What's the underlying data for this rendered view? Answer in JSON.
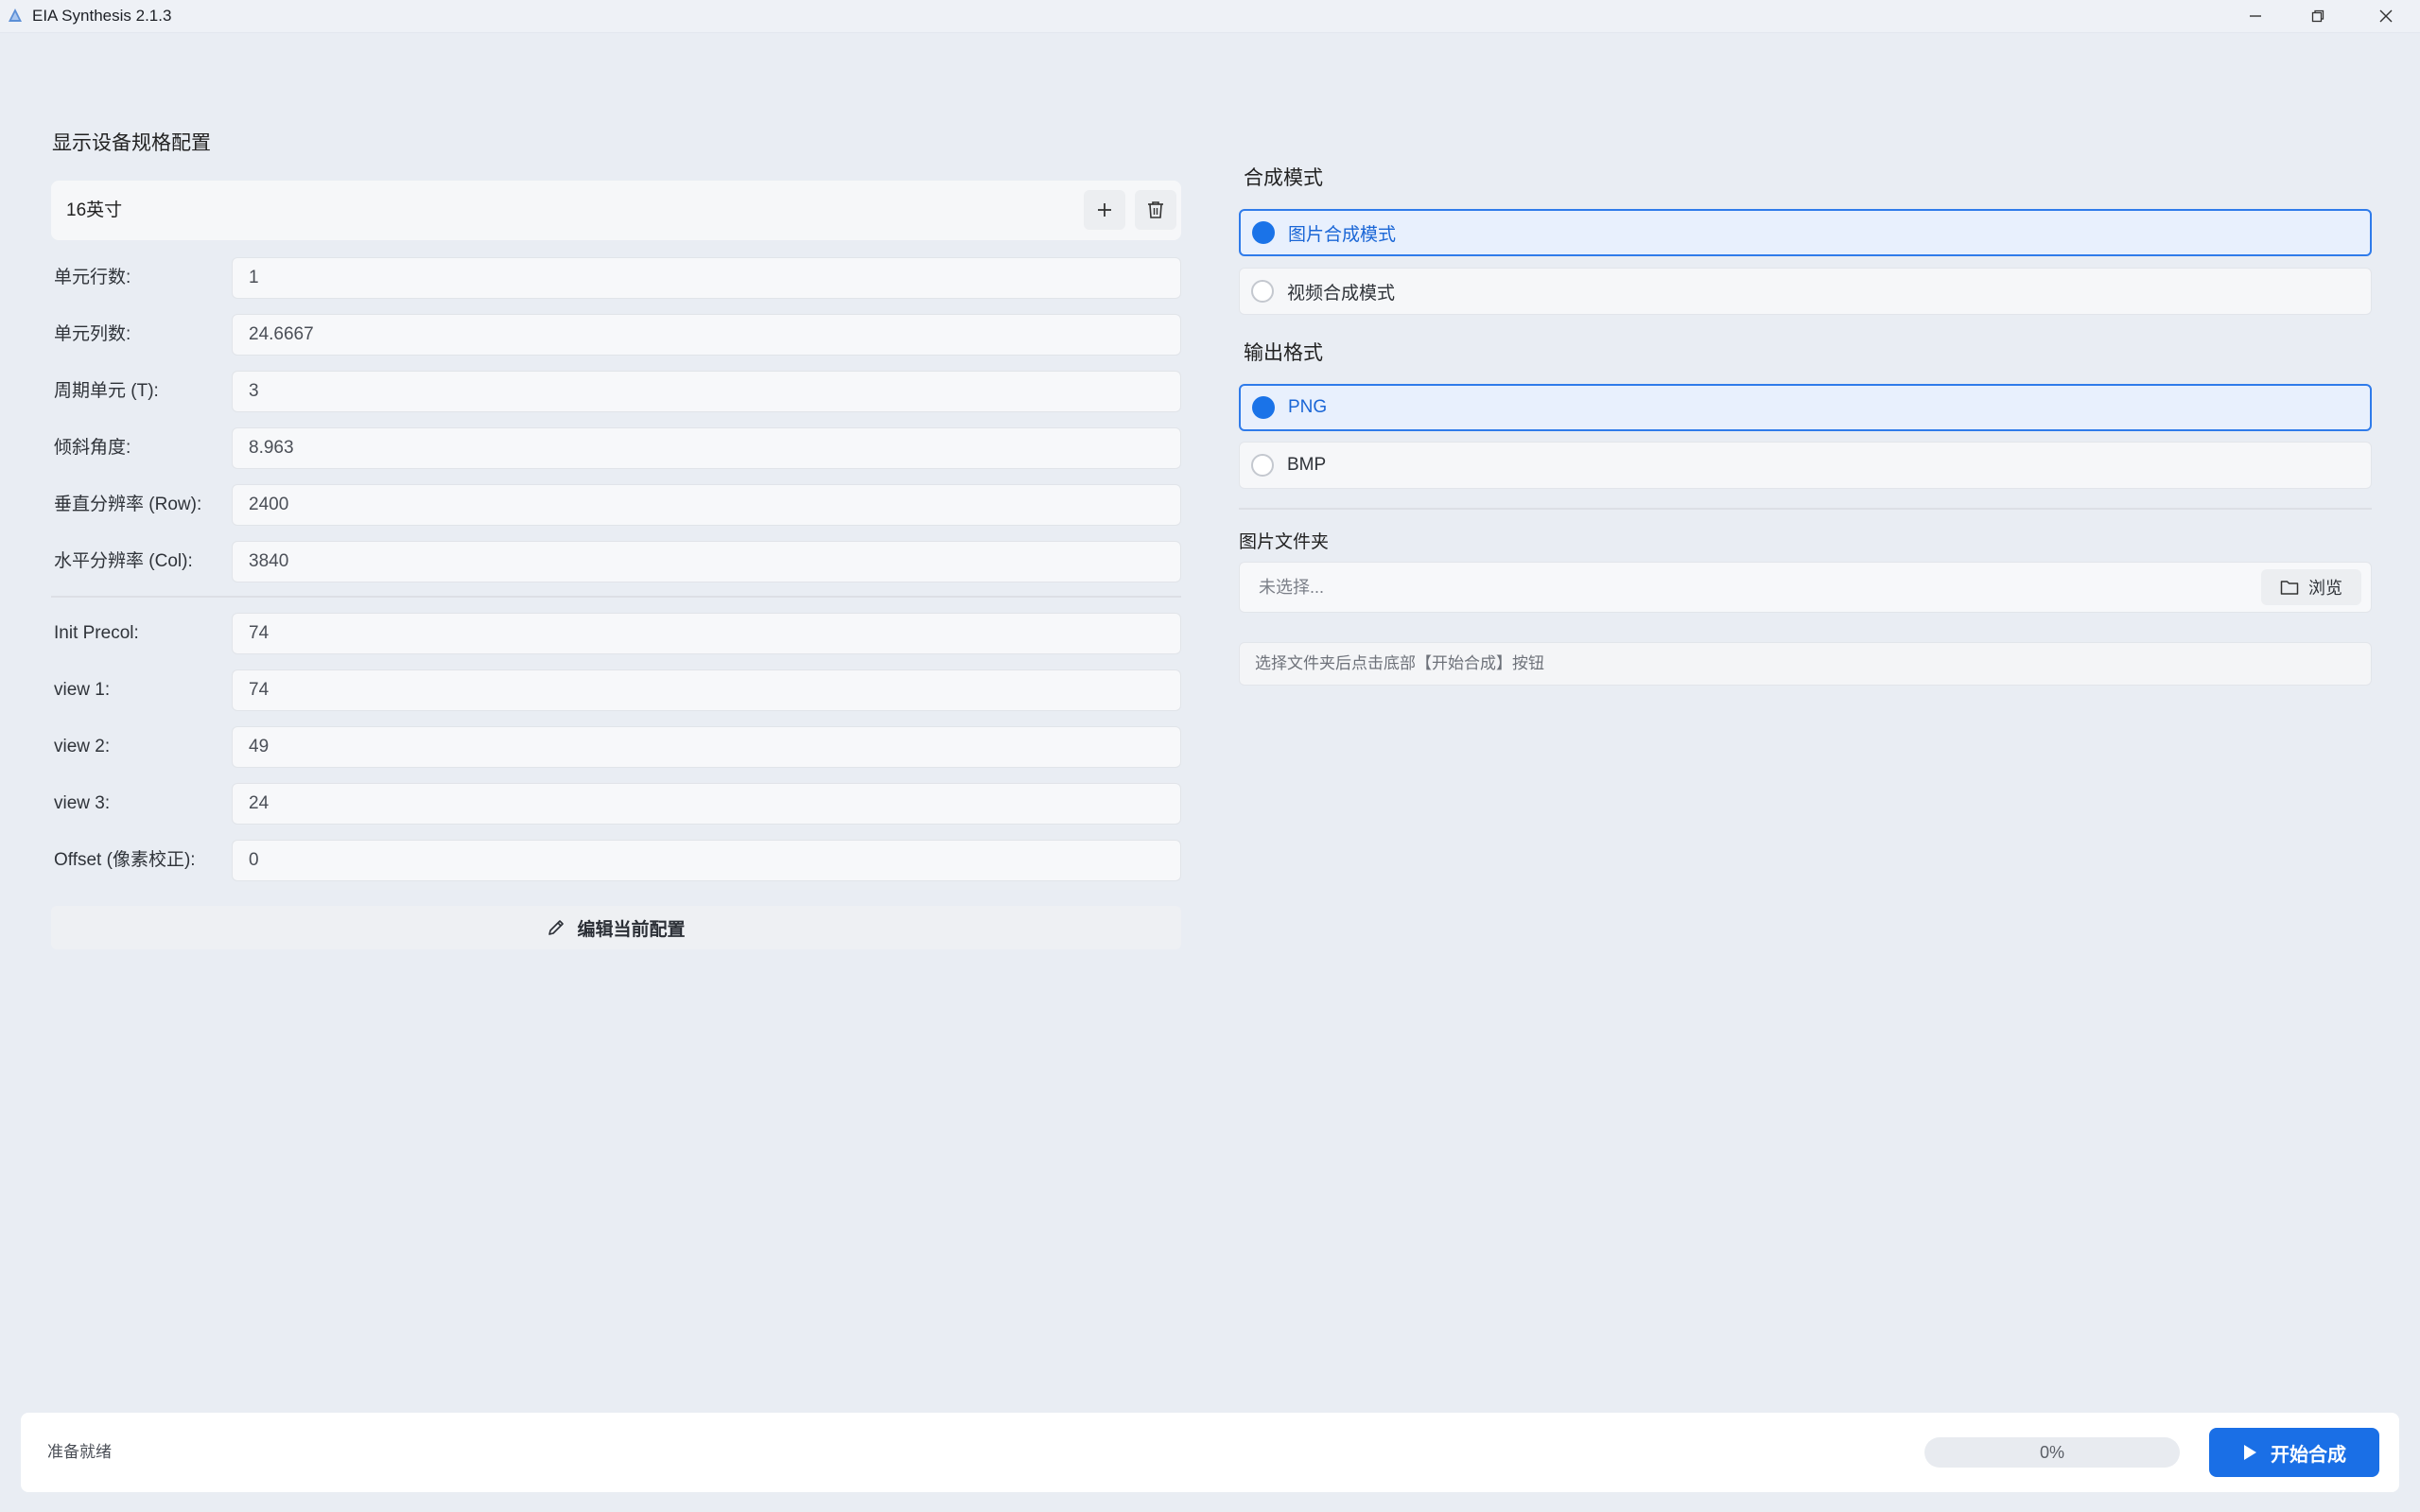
{
  "window": {
    "title": "EIA Synthesis 2.1.3"
  },
  "left_panel": {
    "section_title": "显示设备规格配置",
    "preset": {
      "name": "16英寸",
      "add_icon": "plus-icon",
      "delete_icon": "trash-icon"
    },
    "fields": [
      {
        "label": "单元行数:",
        "value": "1"
      },
      {
        "label": "单元列数:",
        "value": "24.6667"
      },
      {
        "label": "周期单元 (T):",
        "value": "3"
      },
      {
        "label": "倾斜角度:",
        "value": "8.963"
      },
      {
        "label": "垂直分辨率 (Row):",
        "value": "2400"
      },
      {
        "label": "水平分辨率 (Col):",
        "value": "3840"
      },
      {
        "label": "Init Precol:",
        "value": "74"
      },
      {
        "label": "view 1:",
        "value": "74"
      },
      {
        "label": "view 2:",
        "value": "49"
      },
      {
        "label": "view 3:",
        "value": "24"
      },
      {
        "label": "Offset (像素校正):",
        "value": "0"
      }
    ],
    "edit_button_label": "编辑当前配置"
  },
  "right_panel": {
    "mode_title": "合成模式",
    "mode_options": [
      {
        "label": "图片合成模式",
        "selected": true
      },
      {
        "label": "视频合成模式",
        "selected": false
      }
    ],
    "format_title": "输出格式",
    "format_options": [
      {
        "label": "PNG",
        "selected": true
      },
      {
        "label": "BMP",
        "selected": false
      }
    ],
    "folder_title": "图片文件夹",
    "folder_placeholder": "未选择...",
    "browse_label": "浏览",
    "hint": "选择文件夹后点击底部【开始合成】按钮"
  },
  "status_bar": {
    "status": "准备就绪",
    "progress_value": 0,
    "progress_text": "0%",
    "start_label": "开始合成"
  },
  "colors": {
    "accent": "#1a73e8",
    "background": "#e9edf3"
  }
}
